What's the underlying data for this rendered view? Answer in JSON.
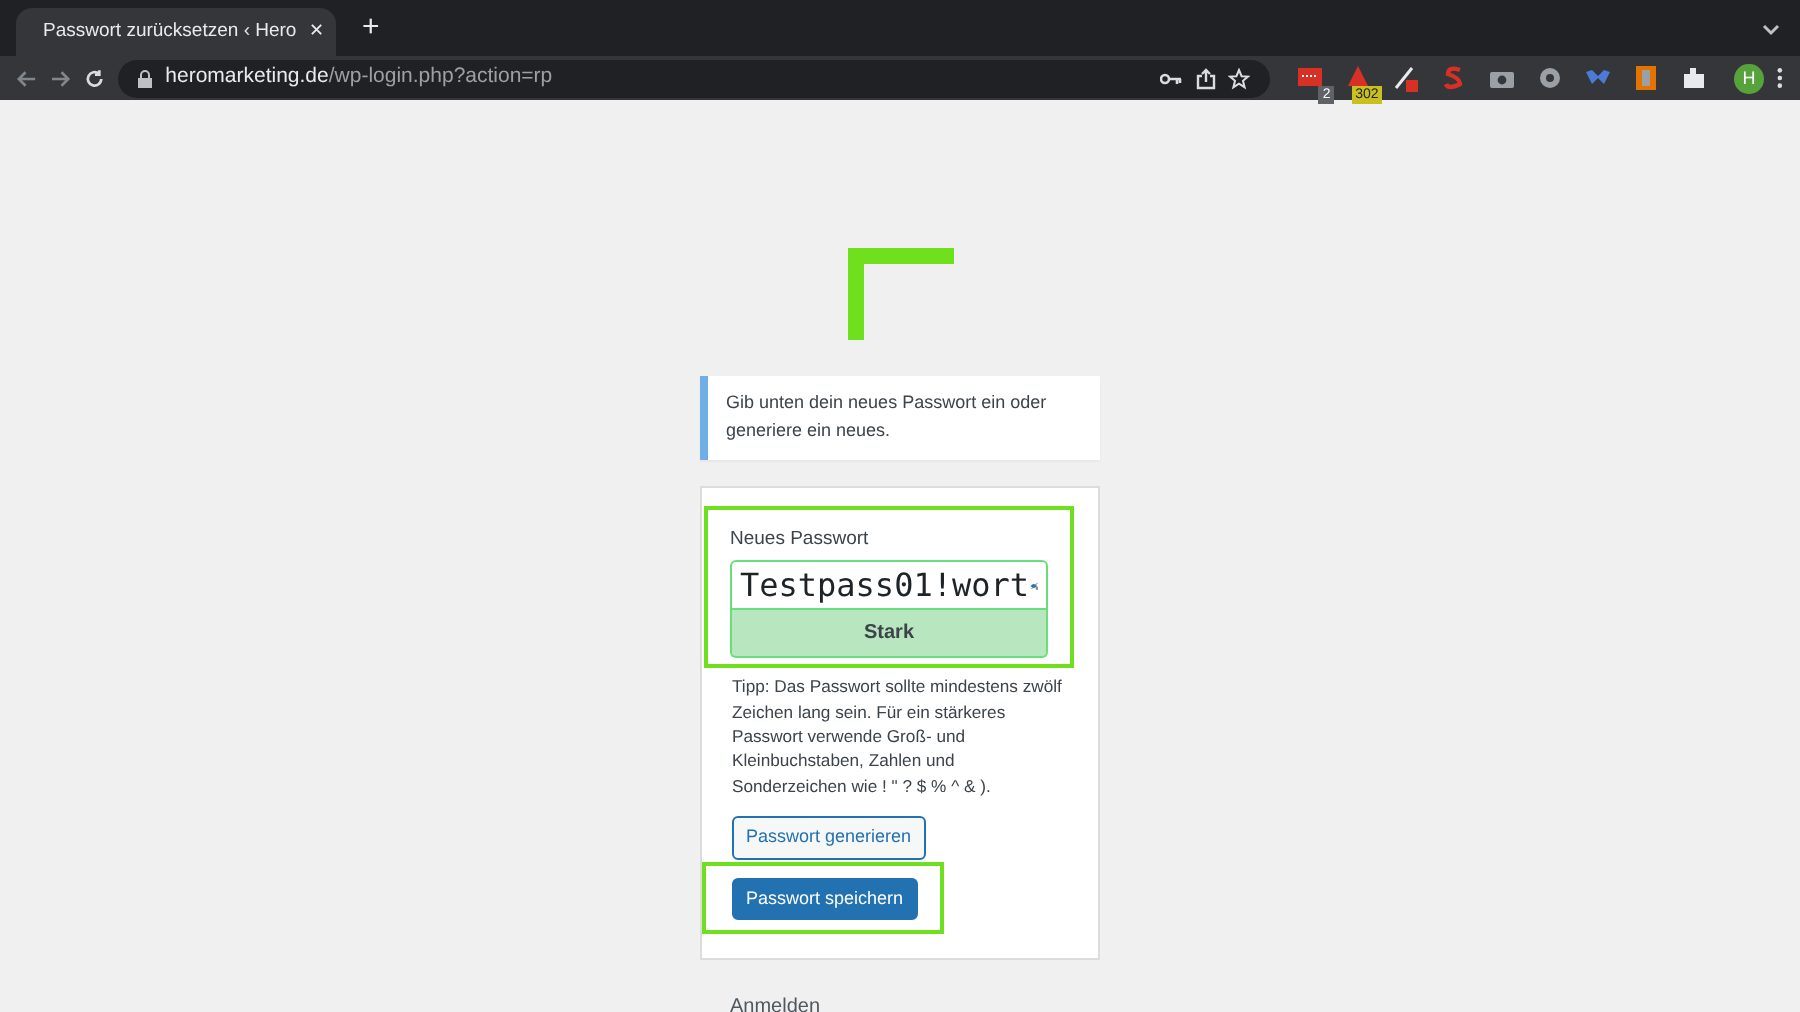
{
  "browser": {
    "tab": {
      "title": "Passwort zurücksetzen ‹ Hero",
      "selected": true,
      "close": "✕"
    },
    "new_tab": "+",
    "url_host": "heromarketing.de",
    "url_path": "/wp-login.php?action=rp",
    "extension_badges": [
      "2",
      "302"
    ],
    "profile": "H"
  },
  "message": "Gib unten dein neues Passwort ein oder generiere ein neues.",
  "form": {
    "label": "Neues Passwort",
    "value": "Testpass01!wort",
    "highlighted": true,
    "strength": {
      "text": "Stark",
      "kind": "strong"
    },
    "hint": "Tipp: Das Passwort sollte mindestens zwölf Zeichen lang sein. Für ein stärkeres Passwort verwende Groß- und Kleinbuchstaben, Zahlen und Sonderzeichen wie ! \" ? $ % ^ & ).",
    "buttons": [
      {
        "label": "Passwort generieren",
        "kind": "secondary",
        "highlighted": false
      },
      {
        "label": "Passwort speichern",
        "kind": "primary",
        "highlighted": true
      }
    ]
  },
  "footer_link": "Anmelden"
}
